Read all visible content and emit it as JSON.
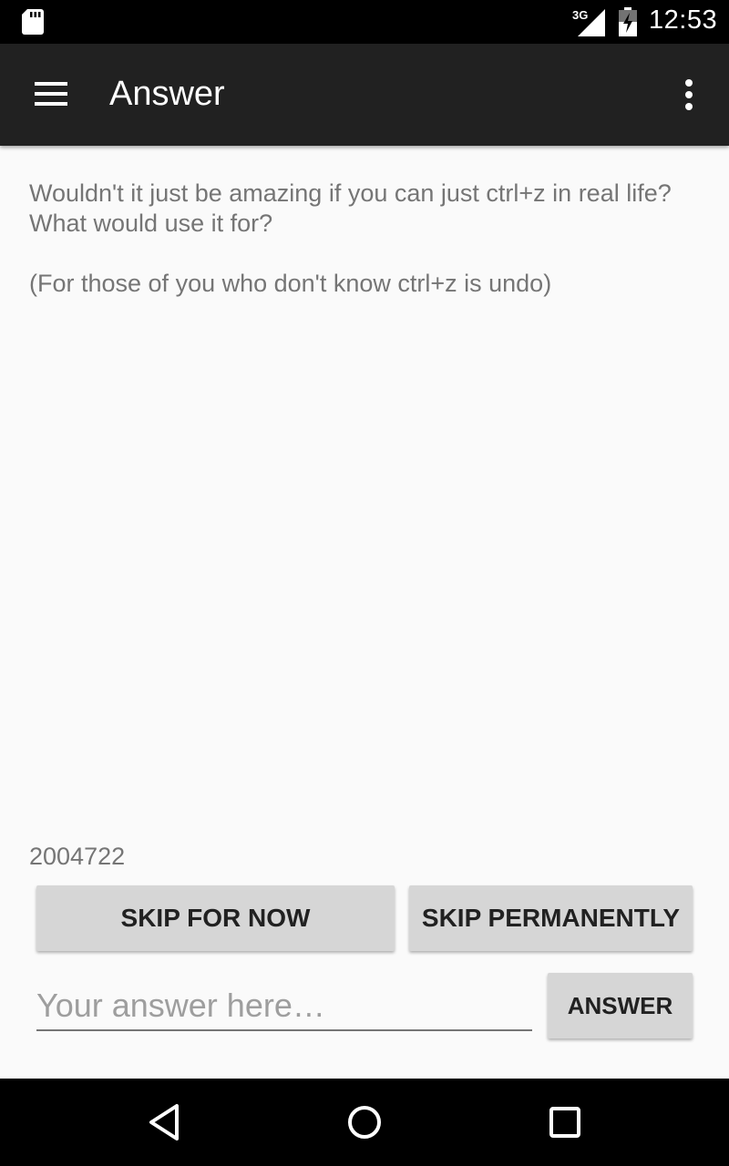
{
  "status_bar": {
    "network": "3G",
    "time": "12:53",
    "icons": [
      "sd-card-icon",
      "signal-icon",
      "battery-icon"
    ]
  },
  "app_bar": {
    "title": "Answer",
    "menu_icon": "hamburger-menu-icon",
    "overflow_icon": "more-vert-icon"
  },
  "question": {
    "text": "Wouldn't it just be amazing if you can just ctrl+z in real life? What would use it for?\n\n(For those of you who don't know ctrl+z is undo)",
    "id": "2004722"
  },
  "actions": {
    "skip_now_label": "SKIP FOR NOW",
    "skip_permanently_label": "SKIP PERMANENTLY",
    "answer_label": "ANSWER"
  },
  "answer_input": {
    "placeholder": "Your answer here…",
    "value": ""
  },
  "nav_bar": {
    "icons": [
      "back-icon",
      "home-icon",
      "recents-icon"
    ]
  },
  "colors": {
    "status_bar": "#000000",
    "app_bar": "#212121",
    "background": "#fafafa",
    "button": "#d6d6d6",
    "secondary_text": "#757575"
  }
}
